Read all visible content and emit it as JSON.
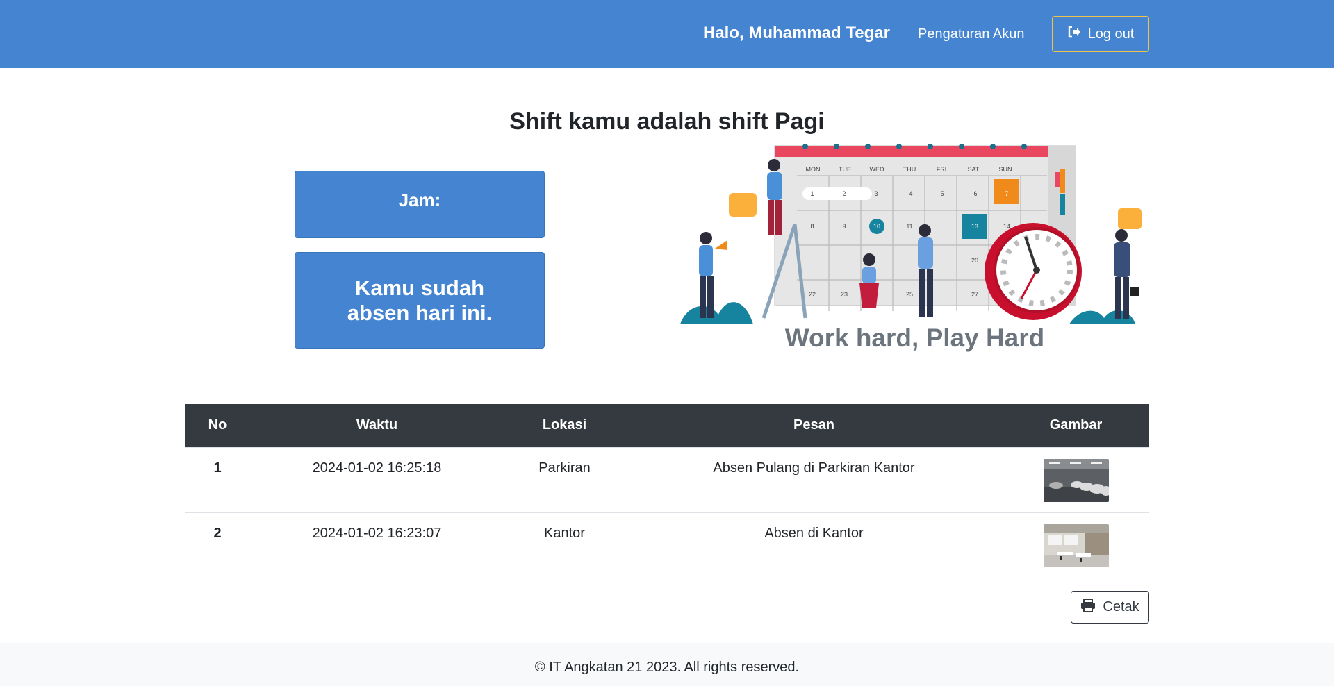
{
  "navbar": {
    "greeting": "Halo, Muhammad Tegar",
    "settings_label": "Pengaturan Akun",
    "logout_label": "Log out",
    "bg_color": "#4484d0",
    "logout_border_color": "#f0c34a"
  },
  "main": {
    "shift_title": "Shift kamu adalah shift Pagi",
    "jam_label": "Jam:",
    "absen_status": "Kamu sudah absen hari ini.",
    "tagline": "Work hard, Play Hard",
    "calendar_days": [
      "MON",
      "TUE",
      "WED",
      "THU",
      "FRI",
      "SAT",
      "SUN"
    ],
    "calendar_numbers": [
      "1",
      "2",
      "3",
      "4",
      "5",
      "6",
      "7",
      "8",
      "9",
      "10",
      "11",
      "13",
      "14",
      "20",
      "22",
      "23",
      "25",
      "27"
    ]
  },
  "table": {
    "headers": [
      "No",
      "Waktu",
      "Lokasi",
      "Pesan",
      "Gambar"
    ],
    "rows": [
      {
        "no": "1",
        "waktu": "2024-01-02 16:25:18",
        "lokasi": "Parkiran",
        "pesan": "Absen Pulang di Parkiran Kantor",
        "gambar_icon": "parking-photo"
      },
      {
        "no": "2",
        "waktu": "2024-01-02 16:23:07",
        "lokasi": "Kantor",
        "pesan": "Absen di Kantor",
        "gambar_icon": "office-photo"
      }
    ]
  },
  "actions": {
    "print_label": "Cetak"
  },
  "footer": {
    "text": "© IT Angkatan 21 2023. All rights reserved."
  }
}
